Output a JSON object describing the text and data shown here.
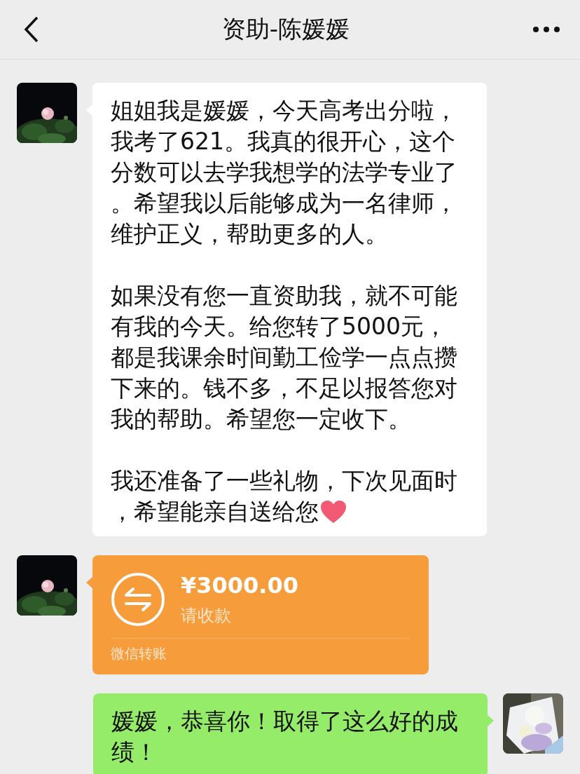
{
  "header": {
    "title": "资助-陈媛媛"
  },
  "messages": [
    {
      "kind": "text",
      "outgoing": false,
      "paragraphs": [
        {
          "lines": [
            "姐姐我是媛媛，今天高考出分啦，",
            "我考了621。我真的很开心，这个",
            "分数可以去学我想学的法学专业了",
            "。希望我以后能够成为一名律师，",
            "维护正义，帮助更多的人。"
          ]
        },
        {
          "lines": [
            "如果没有您一直资助我，就不可能",
            "有我的今天。给您转了5000元，",
            "都是我课余时间勤工俭学一点点攒",
            "下来的。钱不多，不足以报答您对",
            "我的帮助。希望您一定收下。"
          ]
        },
        {
          "lines": [
            "我还准备了一些礼物，下次见面时",
            "，希望能亲自送给您"
          ],
          "heart": true
        }
      ]
    },
    {
      "kind": "transfer",
      "outgoing": false,
      "amount": "¥3000.00",
      "note": "请收款",
      "footer": "微信转账"
    },
    {
      "kind": "text",
      "outgoing": true,
      "paragraphs": [
        {
          "lines": [
            "媛媛，恭喜你！取得了这么好的成",
            "绩！"
          ]
        }
      ]
    }
  ]
}
